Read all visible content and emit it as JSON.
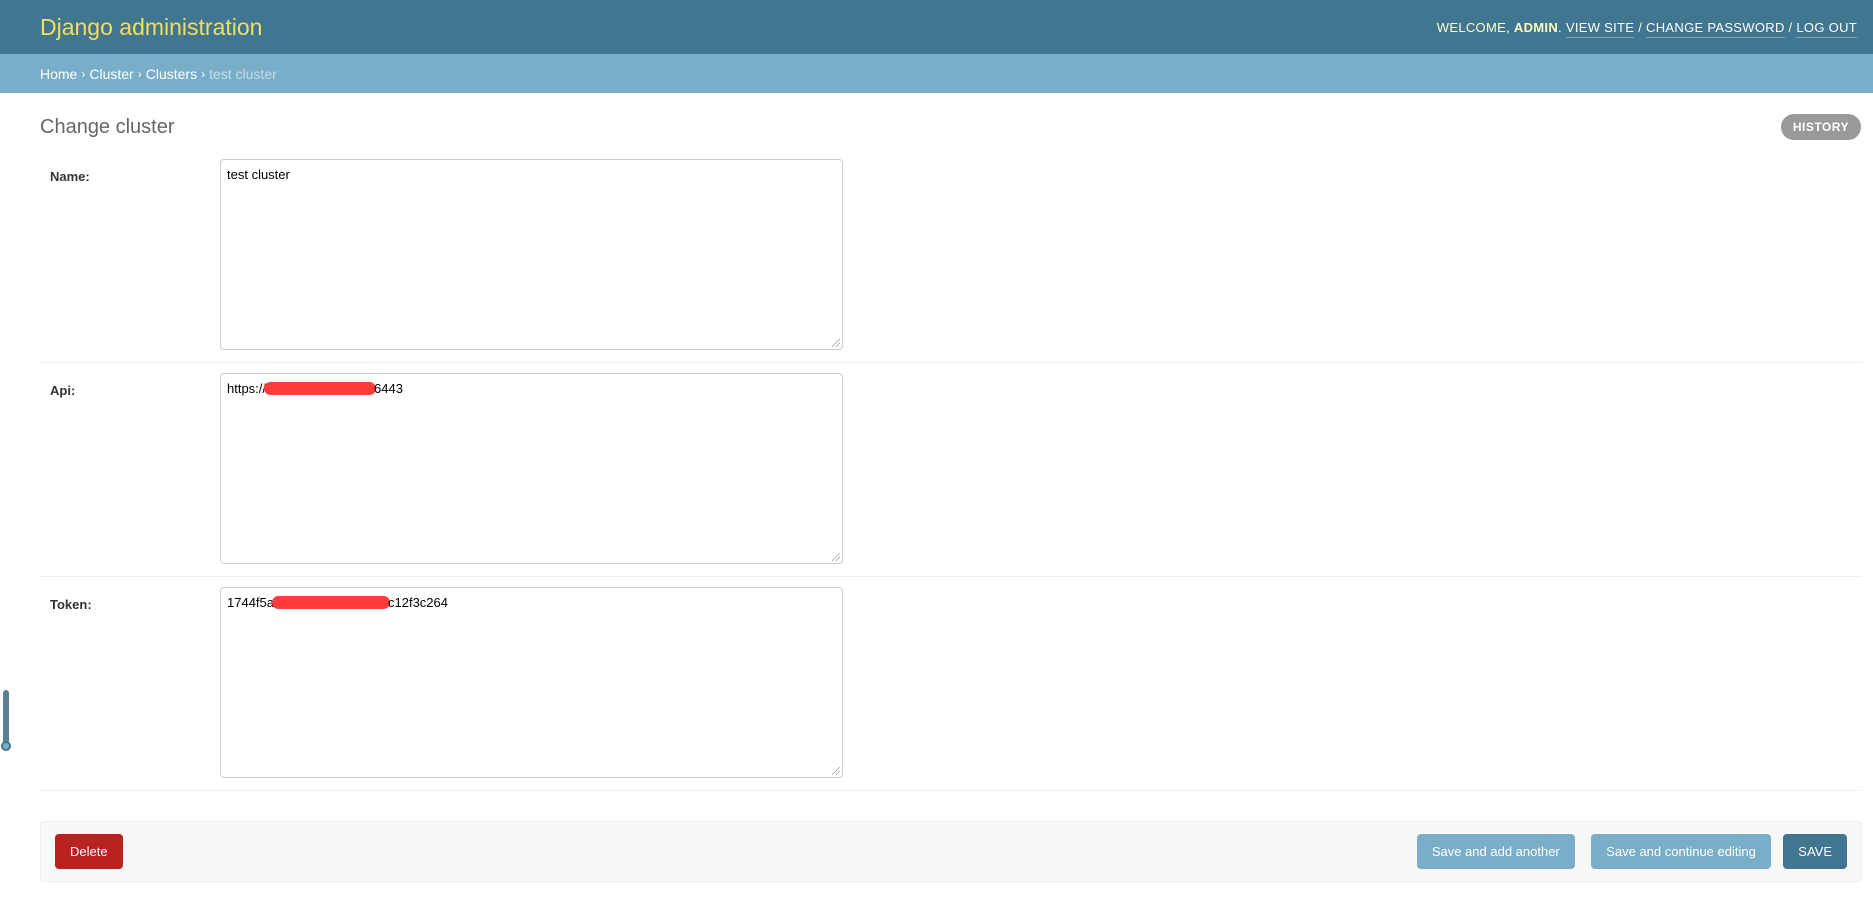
{
  "header": {
    "branding": "Django administration",
    "welcome": "Welcome,",
    "user": "admin",
    "view_site": "View site",
    "change_password": "Change password",
    "log_out": "Log out"
  },
  "breadcrumbs": {
    "home": "Home",
    "app": "Cluster",
    "model": "Clusters",
    "current": "test cluster",
    "separator": "›"
  },
  "page": {
    "title": "Change cluster",
    "history_label": "HISTORY"
  },
  "fields": [
    {
      "label": "Name:",
      "value": "test cluster"
    },
    {
      "label": "Api:",
      "value_prefix": "https://",
      "value_suffix": "6443",
      "redacted": true
    },
    {
      "label": "Token:",
      "value_prefix": "1744f5a",
      "value_suffix": "c12f3c264",
      "redacted": true
    }
  ],
  "submit": {
    "delete": "Delete",
    "save_add": "Save and add another",
    "save_continue": "Save and continue editing",
    "save": "Save"
  },
  "colors": {
    "header": "#417690",
    "breadcrumbs": "#79aec8",
    "branding": "#f5dd5d",
    "delete": "#ba2121",
    "redaction": "#ff3b3b"
  }
}
